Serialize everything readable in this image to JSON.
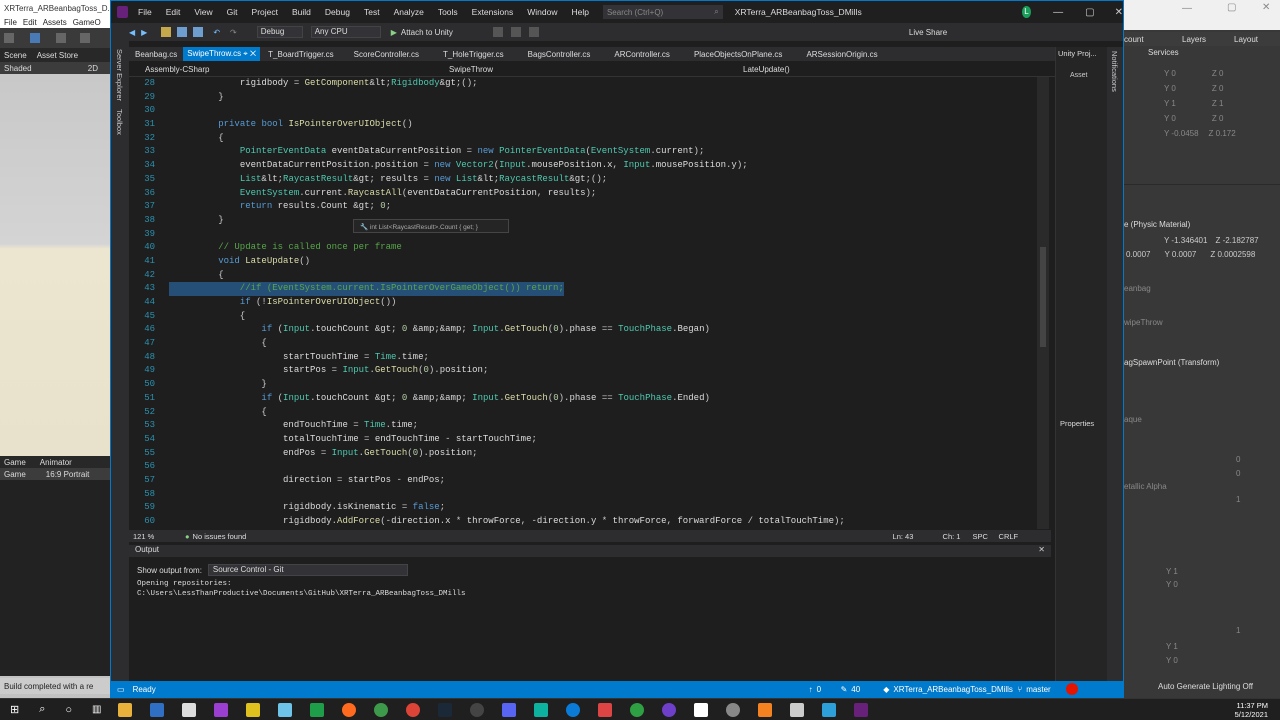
{
  "unity_left": {
    "title": "XRTerra_ARBeanbagToss_D...",
    "menu": [
      "File",
      "Edit",
      "Assets",
      "GameO"
    ],
    "tabs": [
      "Scene",
      "Asset Store"
    ],
    "shaded": "Shaded",
    "shaded_num": "2D",
    "game_tabs": [
      "Game",
      "Animator"
    ],
    "game_label": "Game",
    "aspect": "16:9 Portrait",
    "status": "Build completed with a re"
  },
  "unity_right": {
    "top_tabs": [
      "count",
      "Layers",
      "Layout"
    ],
    "services": "Services",
    "transform_rows": [
      {
        "a": "Y 0",
        "b": "Z 0"
      },
      {
        "a": "Y 0",
        "b": "Z 0"
      },
      {
        "a": "Y 1",
        "b": "Z 1"
      },
      {
        "a": "Y 0",
        "b": "Z 0"
      },
      {
        "a": "Y -0.0458",
        "b": "Z 0.172"
      }
    ],
    "physics_label": "e (Physic Material)",
    "physics_vals": [
      "Y -1.346401",
      "Z -2.182787"
    ],
    "physics_vals2": [
      "0.0007",
      "Y 0.0007",
      "Z 0.0002598"
    ],
    "asset_label": "eanbag",
    "swipe_label": "wipeThrow",
    "spawn_label": "agSpawnPoint (Transform)",
    "que_label": "aque",
    "metallic": "etallic Alpha",
    "mini_vals": [
      "0",
      "0",
      "1",
      "1",
      "0"
    ],
    "bottom_vals": [
      "Y 1",
      "Y 0",
      "1",
      "Y 1",
      "Y 0"
    ],
    "lighting": "Auto Generate Lighting Off"
  },
  "vs": {
    "menu": [
      "File",
      "Edit",
      "View",
      "Git",
      "Project",
      "Build",
      "Debug",
      "Test",
      "Analyze",
      "Tools",
      "Extensions",
      "Window",
      "Help"
    ],
    "search_placeholder": "Search (Ctrl+Q)",
    "solution_title": "XRTerra_ARBeanbagToss_DMills",
    "avatar": "L",
    "live_share": "Live Share",
    "config": "Debug",
    "platform": "Any CPU",
    "attach": "Attach to Unity",
    "tabs": [
      "Beanbag.cs",
      "SwipeThrow.cs",
      "T_BoardTrigger.cs",
      "ScoreController.cs",
      "T_HoleTrigger.cs",
      "BagsController.cs",
      "ARController.cs",
      "PlaceObjectsOnPlane.cs",
      "ARSessionOrigin.cs"
    ],
    "nav_project": "Assembly-CSharp",
    "nav_class": "SwipeThrow",
    "nav_member": "LateUpdate()",
    "side_tabs": [
      "Server Explorer",
      "Toolbox"
    ],
    "tooltip": "int List<RaycastResult>.Count { get; }",
    "zoom": "121 %",
    "issues": "No issues found",
    "position": "Ln: 43",
    "col": "Ch: 1",
    "spc": "SPC",
    "crlf": "CRLF",
    "output_title": "Output",
    "output_source_label": "Show output from:",
    "output_source": "Source Control - Git",
    "output_lines": [
      "Opening repositories:",
      "C:\\Users\\LessThanProductive\\Documents\\GitHub\\XRTerra_ARBeanbagToss_DMills"
    ],
    "ready": "Ready",
    "up": "0",
    "pencil": "40",
    "repo": "XRTerra_ARBeanbagToss_DMills",
    "branch": "master",
    "unity_panel_title": "Unity Proj...",
    "unity_panel_item": "Asset",
    "properties": "Properties",
    "notifications": "Notifications"
  },
  "code": [
    {
      "n": "28",
      "t": "            rigidbody = GetComponent<Rigidbody>();"
    },
    {
      "n": "29",
      "t": "        }"
    },
    {
      "n": "30",
      "t": ""
    },
    {
      "n": "31",
      "t": "        private bool IsPointerOverUIObject()"
    },
    {
      "n": "32",
      "t": "        {"
    },
    {
      "n": "33",
      "t": "            PointerEventData eventDataCurrentPosition = new PointerEventData(EventSystem.current);"
    },
    {
      "n": "34",
      "t": "            eventDataCurrentPosition.position = new Vector2(Input.mousePosition.x, Input.mousePosition.y);"
    },
    {
      "n": "35",
      "t": "            List<RaycastResult> results = new List<RaycastResult>();"
    },
    {
      "n": "36",
      "t": "            EventSystem.current.RaycastAll(eventDataCurrentPosition, results);"
    },
    {
      "n": "37",
      "t": "            return results.Count > 0;"
    },
    {
      "n": "38",
      "t": "        }"
    },
    {
      "n": "39",
      "t": ""
    },
    {
      "n": "40",
      "t": "        // Update is called once per frame"
    },
    {
      "n": "41",
      "t": "        void LateUpdate()"
    },
    {
      "n": "42",
      "t": "        {"
    },
    {
      "n": "43",
      "t": "            //if (EventSystem.current.IsPointerOverGameObject()) return;"
    },
    {
      "n": "44",
      "t": "            if (!IsPointerOverUIObject())"
    },
    {
      "n": "45",
      "t": "            {"
    },
    {
      "n": "46",
      "t": "                if (Input.touchCount > 0 && Input.GetTouch(0).phase == TouchPhase.Began)"
    },
    {
      "n": "47",
      "t": "                {"
    },
    {
      "n": "48",
      "t": "                    startTouchTime = Time.time;"
    },
    {
      "n": "49",
      "t": "                    startPos = Input.GetTouch(0).position;"
    },
    {
      "n": "50",
      "t": "                }"
    },
    {
      "n": "51",
      "t": "                if (Input.touchCount > 0 && Input.GetTouch(0).phase == TouchPhase.Ended)"
    },
    {
      "n": "52",
      "t": "                {"
    },
    {
      "n": "53",
      "t": "                    endTouchTime = Time.time;"
    },
    {
      "n": "54",
      "t": "                    totalTouchTime = endTouchTime - startTouchTime;"
    },
    {
      "n": "55",
      "t": "                    endPos = Input.GetTouch(0).position;"
    },
    {
      "n": "56",
      "t": ""
    },
    {
      "n": "57",
      "t": "                    direction = startPos - endPos;"
    },
    {
      "n": "58",
      "t": ""
    },
    {
      "n": "59",
      "t": "                    rigidbody.isKinematic = false;"
    },
    {
      "n": "60",
      "t": "                    rigidbody.AddForce(-direction.x * throwForce, -direction.y * throwForce, forwardForce / totalTouchTime);"
    }
  ],
  "taskbar": {
    "time": "11:37 PM",
    "date": "5/12/2021"
  },
  "colors": {
    "accent": "#007acc",
    "statusbar": "#007acc",
    "selection": "#264f78"
  }
}
